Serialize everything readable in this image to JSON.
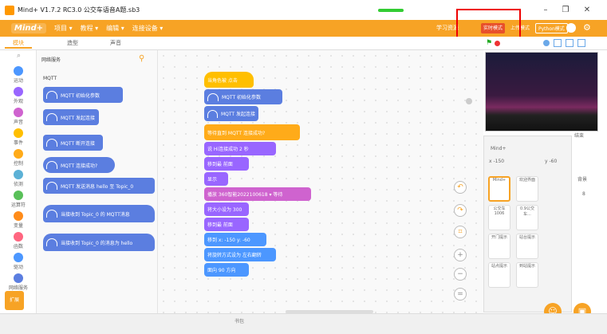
{
  "window": {
    "title": "Mind+ V1.7.2 RC3.0  公交车语音A题.sb3"
  },
  "menubar": {
    "logo": "Mind+",
    "items": [
      "项目 ▾",
      "教程 ▾",
      "编辑 ▾",
      "连接设备 ▾"
    ],
    "learn": "学习资源",
    "modes": [
      "实时模式",
      "上传模式",
      "Python模式"
    ]
  },
  "tabs": {
    "items": [
      "模块",
      "造型",
      "声音"
    ]
  },
  "categories": [
    {
      "label": "运动",
      "color": "#4c97ff"
    },
    {
      "label": "外观",
      "color": "#9966ff"
    },
    {
      "label": "声音",
      "color": "#cf63cf"
    },
    {
      "label": "事件",
      "color": "#ffbf00"
    },
    {
      "label": "控制",
      "color": "#ffab19"
    },
    {
      "label": "侦测",
      "color": "#5cb1d6"
    },
    {
      "label": "运算符",
      "color": "#59c059"
    },
    {
      "label": "变量",
      "color": "#ff8c1a"
    },
    {
      "label": "函数",
      "color": "#ff6680"
    },
    {
      "label": "驱动",
      "color": "#4c97ff"
    },
    {
      "label": "网络服务",
      "color": "#5b7ee0"
    }
  ],
  "extension_button": "扩展",
  "palette": {
    "section_title": "网络服务",
    "subsection": "MQTT",
    "blocks": [
      "MQTT 初始化参数",
      "MQTT 发起连接",
      "MQTT 断开连接",
      "MQTT 连接成功?",
      "MQTT 发送消息 hello 至 Topic_0",
      "当接收到 Topic_0 的 MQTT消息",
      "当接收到 Topic_0 的消息为 hello"
    ]
  },
  "script": {
    "blocks": [
      "当角色被 点击",
      "MQTT 初始化参数",
      "MQTT 发起连接",
      "等待直到 MQTT 连接成功?",
      "说 Hi连接成功 2 秒",
      "移到最 前面",
      "显示",
      "播放 360智能2022100618 ▾ 等待",
      "将大小设为 300",
      "移到最 前面",
      "移到 x: -150 y: -60",
      "将旋转方式设为 左右翻转",
      "面向 90 方向"
    ]
  },
  "stage": {
    "sprite_label": "Mind+",
    "x": "-150",
    "y": "-60"
  },
  "sprites": [
    "Mind+",
    "欢迎界面",
    "公交车1006",
    "0.9公交车...",
    "开门提示",
    "站台提示",
    "站点提示",
    "到站提示"
  ],
  "stage_side": {
    "label": "背景",
    "count": "8"
  },
  "bottombar": {
    "label": "书包"
  }
}
